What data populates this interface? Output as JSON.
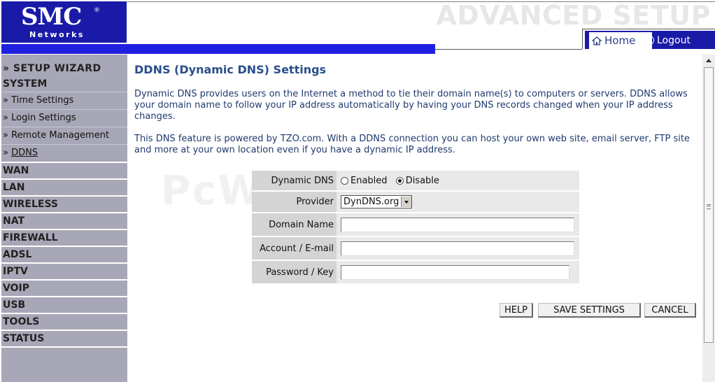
{
  "header": {
    "logo_text": "SMC",
    "logo_reg": "®",
    "logo_sub": "Networks",
    "title": "ADVANCED SETUP",
    "nav": {
      "home_label": "Home",
      "logout_label": "Logout"
    }
  },
  "sidebar": {
    "wizard": "» SETUP WIZARD",
    "system": "SYSTEM",
    "sub_items": [
      {
        "label": "Time Settings"
      },
      {
        "label": "Login Settings"
      },
      {
        "label": "Remote Management"
      },
      {
        "label": "DDNS"
      }
    ],
    "sub_prefix": "»",
    "sections": [
      "WAN",
      "LAN",
      "WIRELESS",
      "NAT",
      "FIREWALL",
      "ADSL",
      "IPTV",
      "VOIP",
      "USB",
      "TOOLS",
      "STATUS"
    ]
  },
  "main": {
    "title": "DDNS (Dynamic DNS) Settings",
    "para1": "Dynamic DNS provides users on the Internet a method to tie their domain name(s) to computers or servers. DDNS allows your domain name to follow your IP address automatically by having your DNS records changed when your IP address changes.",
    "para2": "This DNS feature is powered by TZO.com. With a DDNS connection you can host your own web site, email server, FTP site and more at your own location even if you have a dynamic IP address.",
    "watermark": "PcWintech.com",
    "form": {
      "dynamic_dns_label": "Dynamic DNS",
      "enabled_label": "Enabled",
      "disable_label": "Disable",
      "selected": "Disable",
      "provider_label": "Provider",
      "provider_value": "DynDNS.org",
      "domain_label": "Domain Name",
      "domain_value": "",
      "account_label": "Account / E-mail",
      "account_value": "",
      "password_label": "Password / Key",
      "password_value": ""
    },
    "buttons": {
      "help": "HELP",
      "save": "SAVE SETTINGS",
      "cancel": "CANCEL"
    }
  },
  "colors": {
    "brand": "#1a1aa8",
    "bar": "#2020e0",
    "sidebar": "#a7a7b7",
    "title": "#2a4e8c"
  }
}
